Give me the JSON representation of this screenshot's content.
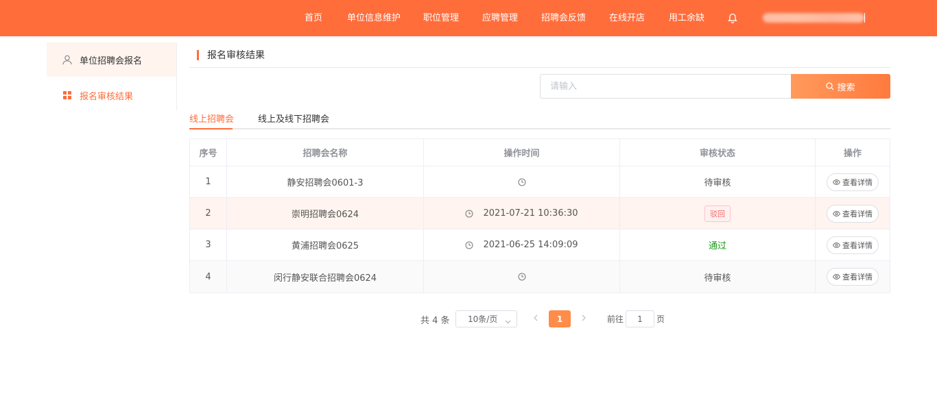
{
  "nav": {
    "items": [
      "首页",
      "单位信息维护",
      "职位管理",
      "应聘管理",
      "招聘会反馈",
      "在线开店",
      "用工余缺"
    ],
    "bell_icon": "bell-icon"
  },
  "sidebar": {
    "items": [
      {
        "label": "单位招聘会报名",
        "icon": "user-icon"
      },
      {
        "label": "报名审核结果",
        "icon": "grid-icon"
      }
    ]
  },
  "content": {
    "title": "报名审核结果",
    "search": {
      "placeholder": "请输入",
      "button_label": "搜索"
    },
    "tabs": [
      "线上招聘会",
      "线上及线下招聘会"
    ],
    "active_tab": 0
  },
  "table": {
    "columns": [
      "序号",
      "招聘会名称",
      "操作时间",
      "审核状态",
      "操作"
    ],
    "rows": [
      {
        "index": "1",
        "name": "静安招聘会0601-3",
        "time": "",
        "status": "待审核"
      },
      {
        "index": "2",
        "name": "崇明招聘会0624",
        "time": "2021-07-21 10:36:30",
        "status": "驳回"
      },
      {
        "index": "3",
        "name": "黄浦招聘会0625",
        "time": "2021-06-25 14:09:09",
        "status": "通过"
      },
      {
        "index": "4",
        "name": "闵行静安联合招聘会0624",
        "time": "",
        "status": "待审核"
      }
    ],
    "action_label": "查看详情"
  },
  "pagination": {
    "total_text": "共 4 条",
    "page_size": "10条/页",
    "current_page": "1",
    "goto_label": "前往",
    "goto_value": "1",
    "page_suffix": "页"
  },
  "colors": {
    "accent": "#ff6d3b",
    "reject": "#f56c6c",
    "pass": "#1a9a1a"
  }
}
